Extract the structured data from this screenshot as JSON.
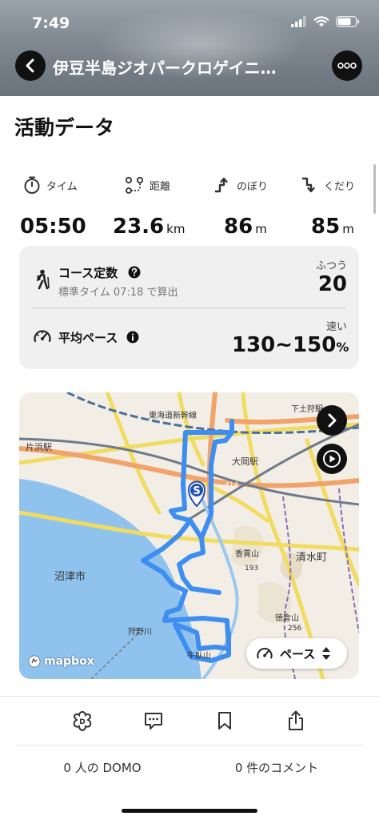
{
  "status": {
    "time": "7:49"
  },
  "header": {
    "title": "伊豆半島ジオパークロゲイニ…"
  },
  "section": {
    "title": "活動データ"
  },
  "stats": [
    {
      "label": "タイム",
      "value": "05:50",
      "unit": "",
      "icon": "stopwatch-icon"
    },
    {
      "label": "距離",
      "value": "23.6",
      "unit": "km",
      "icon": "route-distance-icon"
    },
    {
      "label": "のぼり",
      "value": "86",
      "unit": "m",
      "icon": "ascent-arrow-icon"
    },
    {
      "label": "くだり",
      "value": "85",
      "unit": "m",
      "icon": "descent-arrow-icon"
    }
  ],
  "course": {
    "label": "コース定数",
    "sub": "標準タイム 07:18 で算出",
    "rating": "ふつう",
    "value": "20"
  },
  "pace": {
    "label": "平均ペース",
    "rating": "速い",
    "value": "130~150",
    "unit": "%"
  },
  "map": {
    "labels": {
      "station_katahama": "片浜駅",
      "tokaido_shinkansen": "東海道新幹線",
      "ooka_station": "大岡駅",
      "numazu_city": "沼津市",
      "shimizu_town": "清水町",
      "kanuki_mountain": "香貫山",
      "tokura_mountain": "徳倉山",
      "ushibuse_mountain": "牛臥山",
      "kanoko_river": "狩野川",
      "shimotogari_station": "下土狩駅",
      "route_414": "414",
      "elev_193": "193",
      "elev_256": "256"
    },
    "pace_button": "ペース",
    "logo": "mapbox",
    "start_marker": "S",
    "route_color": "#3d8ef0"
  },
  "bottom": {
    "domo": "0 人の DOMO",
    "comments": "0 件のコメント"
  }
}
